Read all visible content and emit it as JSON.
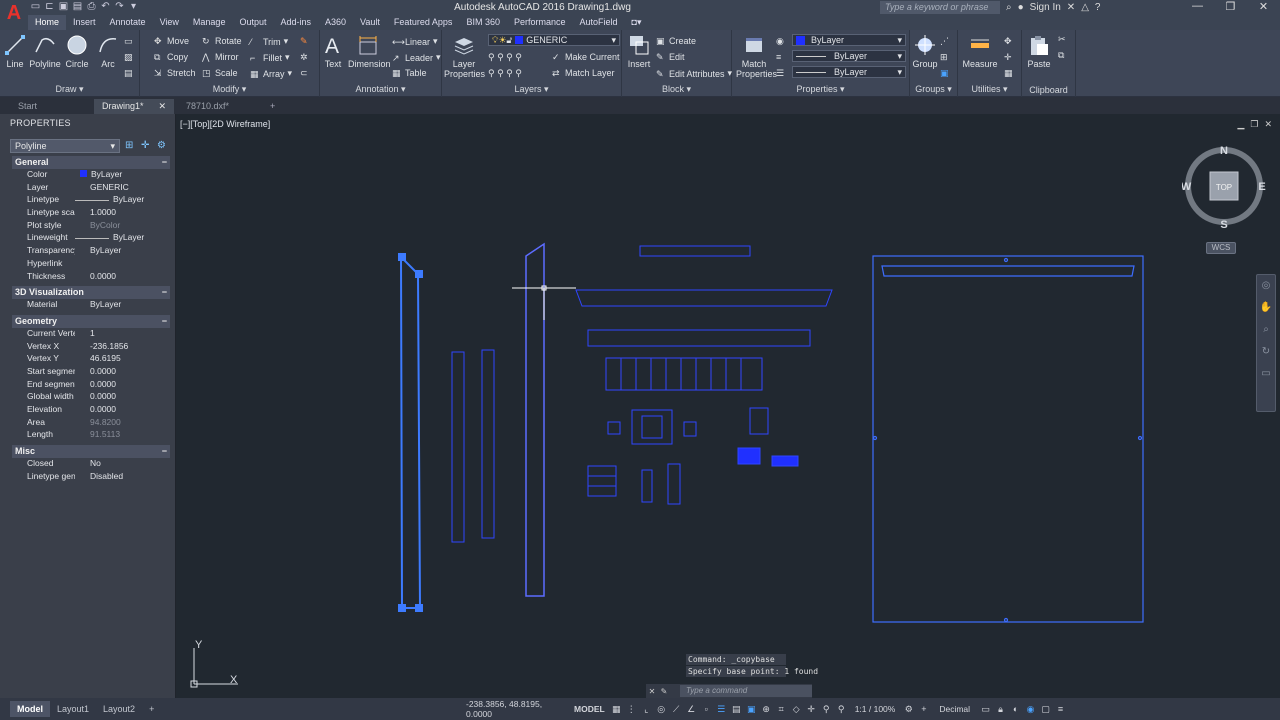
{
  "window": {
    "title": "Autodesk AutoCAD 2016   Drawing1.dwg",
    "search_placeholder": "Type a keyword or phrase",
    "signin": "Sign In"
  },
  "logo": "A",
  "ribbon_tabs": [
    "Home",
    "Insert",
    "Annotate",
    "View",
    "Manage",
    "Output",
    "Add-ins",
    "A360",
    "Vault",
    "Featured Apps",
    "BIM 360",
    "Performance",
    "AutoField"
  ],
  "ribbon": {
    "draw": {
      "title": "Draw",
      "line": "Line",
      "polyline": "Polyline",
      "circle": "Circle",
      "arc": "Arc"
    },
    "modify": {
      "title": "Modify",
      "move": "Move",
      "rotate": "Rotate",
      "trim": "Trim",
      "copy": "Copy",
      "mirror": "Mirror",
      "fillet": "Fillet",
      "stretch": "Stretch",
      "scale": "Scale",
      "array": "Array"
    },
    "annotation": {
      "title": "Annotation",
      "text": "Text",
      "dimension": "Dimension",
      "linear": "Linear",
      "leader": "Leader",
      "table": "Table"
    },
    "layers": {
      "title": "Layers",
      "layer_properties": "Layer Properties",
      "current_layer": "GENERIC",
      "make_current": "Make Current",
      "match_layer": "Match Layer"
    },
    "block": {
      "title": "Block",
      "insert": "Insert",
      "create": "Create",
      "edit": "Edit",
      "edit_attributes": "Edit Attributes"
    },
    "properties": {
      "title": "Properties",
      "match_properties": "Match Properties",
      "color": "ByLayer",
      "linetype": "ByLayer",
      "lineweight": "ByLayer"
    },
    "groups": {
      "title": "Groups",
      "group": "Group"
    },
    "utilities": {
      "title": "Utilities",
      "measure": "Measure"
    },
    "clipboard": {
      "title": "Clipboard",
      "paste": "Paste"
    }
  },
  "file_tabs": [
    "Start",
    "Drawing1*",
    "78710.dxf*"
  ],
  "properties_panel": {
    "title": "PROPERTIES",
    "selection": "Polyline",
    "sections": [
      {
        "name": "General",
        "rows": [
          {
            "k": "Color",
            "v": "ByLayer"
          },
          {
            "k": "Layer",
            "v": "GENERIC"
          },
          {
            "k": "Linetype",
            "v": "ByLayer"
          },
          {
            "k": "Linetype scale",
            "v": "1.0000"
          },
          {
            "k": "Plot style",
            "v": "ByColor"
          },
          {
            "k": "Lineweight",
            "v": "ByLayer"
          },
          {
            "k": "Transparency",
            "v": "ByLayer"
          },
          {
            "k": "Hyperlink",
            "v": ""
          },
          {
            "k": "Thickness",
            "v": "0.0000"
          }
        ]
      },
      {
        "name": "3D Visualization",
        "rows": [
          {
            "k": "Material",
            "v": "ByLayer"
          }
        ]
      },
      {
        "name": "Geometry",
        "rows": [
          {
            "k": "Current Vertex",
            "v": "1"
          },
          {
            "k": "Vertex X",
            "v": "-236.1856"
          },
          {
            "k": "Vertex Y",
            "v": "46.6195"
          },
          {
            "k": "Start segment...",
            "v": "0.0000"
          },
          {
            "k": "End segment...",
            "v": "0.0000"
          },
          {
            "k": "Global width",
            "v": "0.0000"
          },
          {
            "k": "Elevation",
            "v": "0.0000"
          },
          {
            "k": "Area",
            "v": "94.8200"
          },
          {
            "k": "Length",
            "v": "91.5113"
          }
        ]
      },
      {
        "name": "Misc",
        "rows": [
          {
            "k": "Closed",
            "v": "No"
          },
          {
            "k": "Linetype gene...",
            "v": "Disabled"
          }
        ]
      }
    ]
  },
  "viewport": {
    "label": "[−][Top][2D Wireframe]",
    "cube": {
      "n": "N",
      "s": "S",
      "e": "E",
      "w": "W",
      "face": "TOP"
    },
    "wcs": "WCS",
    "ucs_x": "X",
    "ucs_y": "Y"
  },
  "command": {
    "history": [
      "Command: _copybase",
      "Specify base point: 1 found"
    ],
    "placeholder": "Type a command"
  },
  "layout_tabs": [
    "Model",
    "Layout1",
    "Layout2"
  ],
  "status": {
    "coords": "-238.3856, 48.8195, 0.0000",
    "space": "MODEL",
    "scale": "1:1 / 100%",
    "units": "Decimal"
  },
  "colors": {
    "accent": "#4aa3ff",
    "geometry": "#2f46ff",
    "highlight": "#3d7bff"
  }
}
